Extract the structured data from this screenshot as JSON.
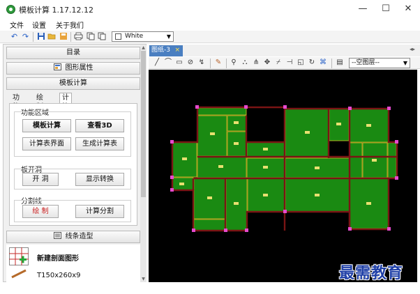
{
  "window": {
    "title": "模板计算 1.17.12.12",
    "minimize": "—",
    "maximize": "☐",
    "close": "✕"
  },
  "menu": [
    "文件",
    "设置",
    "关于我们"
  ],
  "toolbar": {
    "color_value": "White"
  },
  "left_panel": {
    "header_directory": "目录",
    "header_properties": "图形属性",
    "header_calc": "模板计算",
    "header_lines": "线条造型",
    "tabs": [
      "功能区",
      "绘制区",
      "计算区"
    ],
    "active_tab": 2,
    "group_function": "功能区域",
    "btn_calc": "模板计算",
    "btn_view3d": "查看3D",
    "btn_calc_ui": "计算表界面",
    "btn_gen_table": "生成计算表",
    "group_opening": "板开洞",
    "btn_open": "开 洞",
    "btn_toggle": "显示转换",
    "group_divider": "分割线",
    "btn_draw": "绘 制",
    "btn_calc_split": "计算分割",
    "new_section": "新建剖面图形",
    "section_size": "T150x260x9"
  },
  "document": {
    "tab_label": "图纸-3",
    "tab_close": "×",
    "layer_value": "--空图层--"
  },
  "watermark": "最需教育",
  "colors": {
    "canvas": "#000000",
    "slab": "#1a8a12",
    "beam": "#7a1414",
    "node": "#e64ad0",
    "accent": "#4a7fc1"
  }
}
